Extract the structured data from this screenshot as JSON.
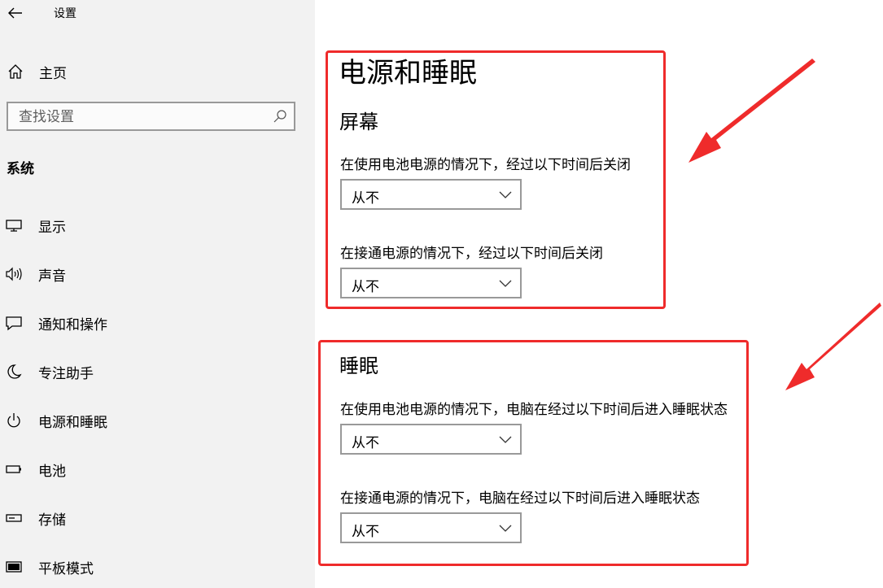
{
  "window": {
    "title": "设置"
  },
  "sidebar": {
    "home_label": "主页",
    "search_placeholder": "查找设置",
    "section": "系统",
    "items": [
      {
        "label": "显示",
        "icon": "monitor-icon"
      },
      {
        "label": "声音",
        "icon": "speaker-icon"
      },
      {
        "label": "通知和操作",
        "icon": "notification-icon"
      },
      {
        "label": "专注助手",
        "icon": "moon-icon"
      },
      {
        "label": "电源和睡眠",
        "icon": "power-icon"
      },
      {
        "label": "电池",
        "icon": "battery-icon"
      },
      {
        "label": "存储",
        "icon": "storage-icon"
      },
      {
        "label": "平板模式",
        "icon": "tablet-icon"
      }
    ]
  },
  "main": {
    "title": "电源和睡眠",
    "screen": {
      "title": "屏幕",
      "battery_label": "在使用电池电源的情况下，经过以下时间后关闭",
      "battery_value": "从不",
      "plugged_label": "在接通电源的情况下，经过以下时间后关闭",
      "plugged_value": "从不"
    },
    "sleep": {
      "title": "睡眠",
      "battery_label": "在使用电池电源的情况下，电脑在经过以下时间后进入睡眠状态",
      "battery_value": "从不",
      "plugged_label": "在接通电源的情况下，电脑在经过以下时间后进入睡眠状态",
      "plugged_value": "从不"
    }
  },
  "colors": {
    "sidebar_bg": "#f2f2f2",
    "annotation_red": "#ef2b2b",
    "field_border": "#999999"
  }
}
